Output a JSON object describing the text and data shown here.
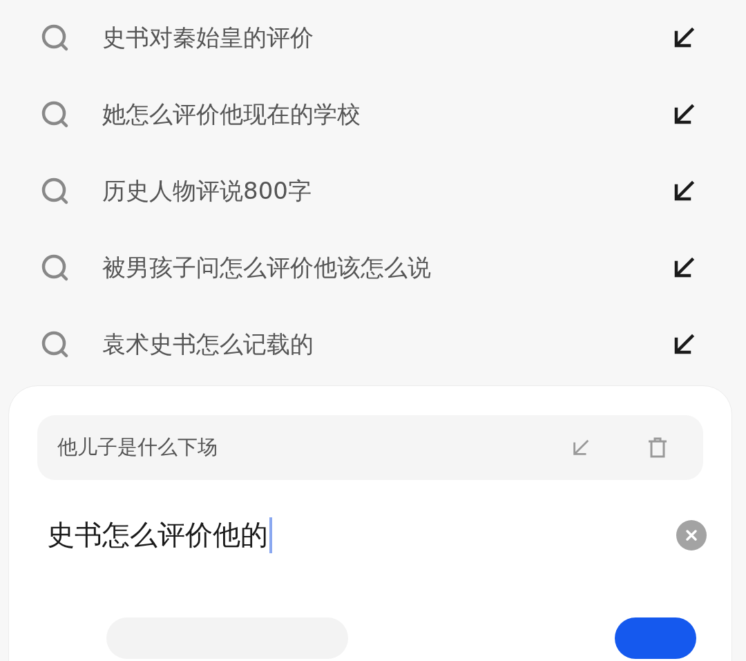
{
  "suggestions": [
    {
      "text": "史书对秦始皇的评价"
    },
    {
      "text": "她怎么评价他现在的学校"
    },
    {
      "text": "历史人物评说800字"
    },
    {
      "text": "被男孩子问怎么评价他该怎么说"
    },
    {
      "text": "袁术史书怎么记载的"
    }
  ],
  "history": {
    "text": "他儿子是什么下场"
  },
  "search": {
    "value": "史书怎么评价他的"
  }
}
